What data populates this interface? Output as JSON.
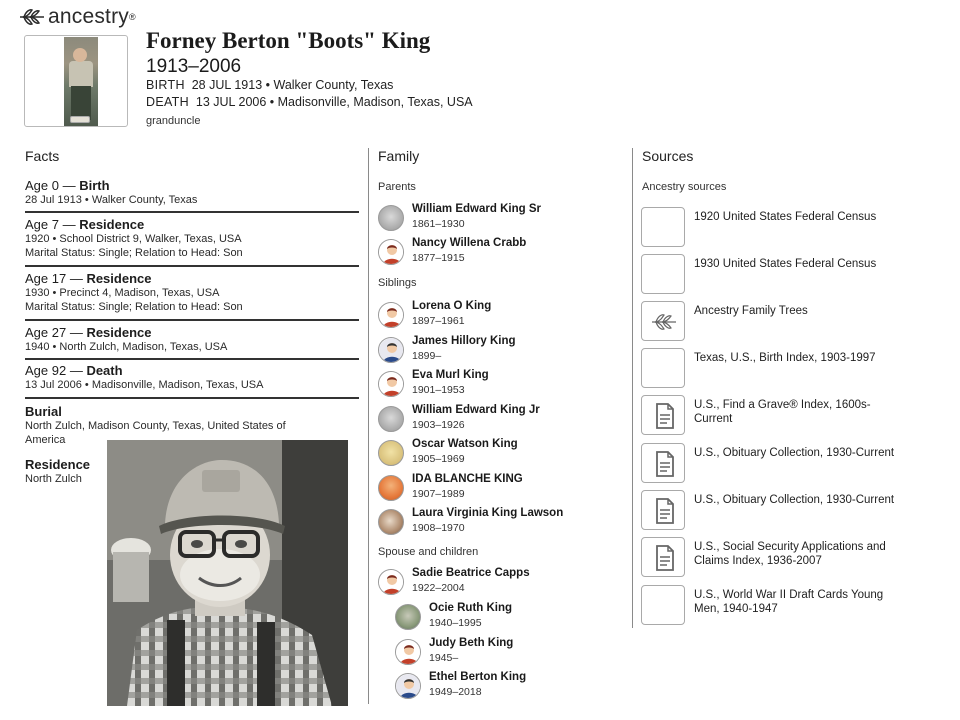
{
  "brand": {
    "name": "ancestry",
    "icon": "leaf-logo-icon"
  },
  "person": {
    "name": "Forney Berton \"Boots\" King",
    "years": "1913–2006",
    "birth_label": "BIRTH",
    "birth_value": "28 JUL 1913 • Walker County, Texas",
    "death_label": "DEATH",
    "death_value": "13 JUL 2006 • Madisonville, Madison, Texas, USA",
    "relation": "granduncle"
  },
  "facts": {
    "title": "Facts",
    "items": [
      {
        "age": "Age 0 — ",
        "event": "Birth",
        "lines": [
          "28 Jul 1913 • Walker County, Texas"
        ]
      },
      {
        "age": "Age 7 — ",
        "event": "Residence",
        "lines": [
          "1920 • School District 9, Walker, Texas, USA",
          "Marital Status: Single; Relation to Head: Son"
        ]
      },
      {
        "age": "Age 17 — ",
        "event": "Residence",
        "lines": [
          "1930 • Precinct 4, Madison, Texas, USA",
          "Marital Status: Single; Relation to Head: Son"
        ]
      },
      {
        "age": "Age 27 — ",
        "event": "Residence",
        "lines": [
          "1940 • North Zulch, Madison, Texas, USA"
        ]
      },
      {
        "age": "Age 92 — ",
        "event": "Death",
        "lines": [
          "13 Jul 2006 • Madisonville, Madison, Texas, USA"
        ]
      }
    ],
    "burial": {
      "event": "Burial",
      "lines": [
        "North Zulch, Madison County, Texas, United States of",
        "America"
      ]
    },
    "residence": {
      "event": "Residence",
      "lines": [
        "North Zulch"
      ]
    }
  },
  "family": {
    "title": "Family",
    "parents_label": "Parents",
    "parents": [
      {
        "name": "William Edward King Sr",
        "years": "1861–1930",
        "avatar": "photo-gray"
      },
      {
        "name": "Nancy Willena Crabb",
        "years": "1877–1915",
        "avatar": "female"
      }
    ],
    "siblings_label": "Siblings",
    "siblings": [
      {
        "name": "Lorena O King",
        "years": "1897–1961",
        "avatar": "female"
      },
      {
        "name": "James Hillory King",
        "years": "1899–",
        "avatar": "male"
      },
      {
        "name": "Eva Murl King",
        "years": "1901–1953",
        "avatar": "female"
      },
      {
        "name": "William Edward King Jr",
        "years": "1903–1926",
        "avatar": "photo-gray"
      },
      {
        "name": "Oscar Watson King",
        "years": "1905–1969",
        "avatar": "photo-yellow"
      },
      {
        "name": "IDA BLANCHE KING",
        "years": "1907–1989",
        "avatar": "photo-orange"
      },
      {
        "name": "Laura Virginia King Lawson",
        "years": "1908–1970",
        "avatar": "photo-sepia"
      }
    ],
    "spouse_label": "Spouse and children",
    "spouse": {
      "name": "Sadie Beatrice Capps",
      "years": "1922–2004",
      "avatar": "female"
    },
    "children": [
      {
        "name": "Ocie Ruth King",
        "years": "1940–1995",
        "avatar": "photo-green"
      },
      {
        "name": "Judy Beth King",
        "years": "1945–",
        "avatar": "female"
      },
      {
        "name": "Ethel Berton King",
        "years": "1949–2018",
        "avatar": "male"
      }
    ]
  },
  "sources": {
    "title": "Sources",
    "subtitle": "Ancestry sources",
    "items": [
      {
        "label": "1920 United States Federal Census",
        "thumb": "census-doc-icon"
      },
      {
        "label": "1930 United States Federal Census",
        "thumb": "census-doc-dark-icon"
      },
      {
        "label": "Ancestry Family Trees",
        "thumb": "leaf-logo-icon"
      },
      {
        "label": "Texas, U.S., Birth Index, 1903-1997",
        "thumb": "index-doc-icon"
      },
      {
        "label": "U.S., Find a Grave® Index, 1600s-Current",
        "thumb": "document-icon"
      },
      {
        "label": "U.S., Obituary Collection, 1930-Current",
        "thumb": "document-icon"
      },
      {
        "label": "U.S., Obituary Collection, 1930-Current",
        "thumb": "document-icon"
      },
      {
        "label": "U.S., Social Security Applications and Claims Index, 1936-2007",
        "thumb": "document-icon"
      },
      {
        "label": "U.S., World War II Draft Cards Young Men, 1940-1947",
        "thumb": "draft-card-icon"
      }
    ]
  }
}
